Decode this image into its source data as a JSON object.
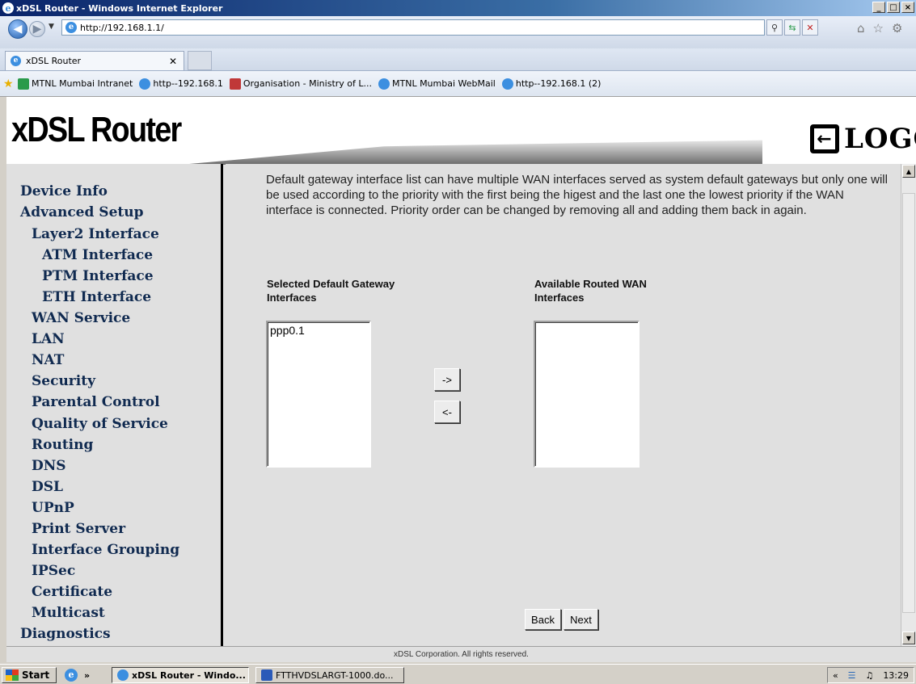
{
  "window": {
    "title": "xDSL Router - Windows Internet Explorer",
    "buttons": [
      "_",
      "□",
      "×"
    ]
  },
  "browser": {
    "url": "http://192.168.1.1/",
    "tab_title": "xDSL Router",
    "favorites": [
      {
        "label": "MTNL Mumbai Intranet",
        "icon": "intranet-icon",
        "color": "#2a9a4a"
      },
      {
        "label": "http--192.168.1",
        "icon": "ie-page-icon",
        "color": "#3c8fe0"
      },
      {
        "label": "Organisation - Ministry of L...",
        "icon": "emblem-icon",
        "color": "#c03838"
      },
      {
        "label": "MTNL Mumbai WebMail",
        "icon": "ie-page-icon",
        "color": "#3c8fe0"
      },
      {
        "label": "http--192.168.1 (2)",
        "icon": "ie-page-icon",
        "color": "#3c8fe0"
      }
    ]
  },
  "header": {
    "title": "xDSL Router",
    "logout": "LOGOUT"
  },
  "sidebar": {
    "items": [
      {
        "label": "Device Info",
        "level": 0
      },
      {
        "label": "Advanced Setup",
        "level": 0
      },
      {
        "label": "Layer2 Interface",
        "level": 1
      },
      {
        "label": "ATM Interface",
        "level": 2
      },
      {
        "label": "PTM Interface",
        "level": 2
      },
      {
        "label": "ETH Interface",
        "level": 2
      },
      {
        "label": "WAN Service",
        "level": 1
      },
      {
        "label": "LAN",
        "level": 1
      },
      {
        "label": "NAT",
        "level": 1
      },
      {
        "label": "Security",
        "level": 1
      },
      {
        "label": "Parental Control",
        "level": 1
      },
      {
        "label": "Quality of Service",
        "level": 1
      },
      {
        "label": "Routing",
        "level": 1
      },
      {
        "label": "DNS",
        "level": 1
      },
      {
        "label": "DSL",
        "level": 1
      },
      {
        "label": "UPnP",
        "level": 1
      },
      {
        "label": "Print Server",
        "level": 1
      },
      {
        "label": "Interface Grouping",
        "level": 1
      },
      {
        "label": "IPSec",
        "level": 1
      },
      {
        "label": "Certificate",
        "level": 1
      },
      {
        "label": "Multicast",
        "level": 1
      },
      {
        "label": "Diagnostics",
        "level": 0
      }
    ]
  },
  "main": {
    "intro": "Default gateway interface list can have multiple WAN interfaces served as system default gateways but only one will be used according to the priority with the first being the higest and the last one the lowest priority if the WAN interface is connected. Priority order can be changed by removing all and adding them back in again.",
    "selected_heading": "Selected Default Gateway Interfaces",
    "available_heading": "Available Routed WAN Interfaces",
    "selected_items": [
      "ppp0.1"
    ],
    "available_items": [],
    "move_right": "->",
    "move_left": "<-",
    "back": "Back",
    "next": "Next"
  },
  "footer": "xDSL Corporation. All rights reserved.",
  "taskbar": {
    "start": "Start",
    "quicklaunch_more": "»",
    "tasks": [
      "xDSL Router - Windo...",
      "FTTHVDSLARGT-1000.do..."
    ],
    "tray_more": "«",
    "clock": "13:29"
  }
}
